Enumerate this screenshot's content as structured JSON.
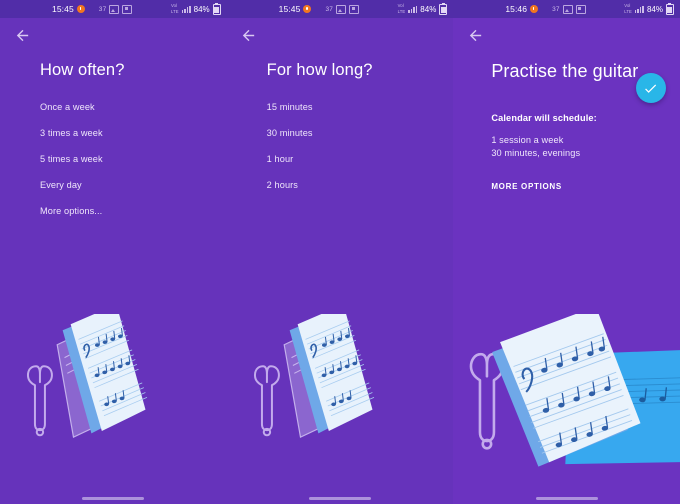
{
  "theme": {
    "background": "#6633bb",
    "statusbar_background": "#512da8",
    "accent_fab": "#29b6e8",
    "text_primary": "#ffffff",
    "text_secondary": "#efe6fb"
  },
  "screens": [
    {
      "status": {
        "time": "15:45",
        "network_line1": "Vol",
        "network_line2": "LTE1",
        "network_line3": "LTE",
        "network_line4": "2",
        "data_label": "37",
        "battery_text": "84%"
      },
      "back_icon": "arrow-left-icon",
      "headline": "How often?",
      "options": [
        "Once a week",
        "3 times a week",
        "5 times a week",
        "Every day",
        "More options..."
      ],
      "illustration": "sheet-music-and-tuning-fork"
    },
    {
      "status": {
        "time": "15:45",
        "network_line1": "Vol",
        "network_line2": "LTE1",
        "network_line3": "LTE",
        "network_line4": "2",
        "data_label": "37",
        "battery_text": "84%"
      },
      "back_icon": "arrow-left-icon",
      "headline": "For how long?",
      "options": [
        "15 minutes",
        "30 minutes",
        "1 hour",
        "2 hours"
      ],
      "illustration": "sheet-music-and-tuning-fork"
    },
    {
      "status": {
        "time": "15:46",
        "network_line1": "Vol",
        "network_line2": "LTE1",
        "network_line3": "LTE",
        "network_line4": "2",
        "data_label": "37",
        "battery_text": "84%"
      },
      "back_icon": "arrow-left-icon",
      "headline": "Practise the guitar",
      "confirm_icon": "check-icon",
      "summary_label": "Calendar will schedule:",
      "summary_lines": [
        "1 session a week",
        "30 minutes, evenings"
      ],
      "more_options_label": "MORE OPTIONS",
      "illustration": "sheet-music-and-tuning-fork-large"
    }
  ]
}
